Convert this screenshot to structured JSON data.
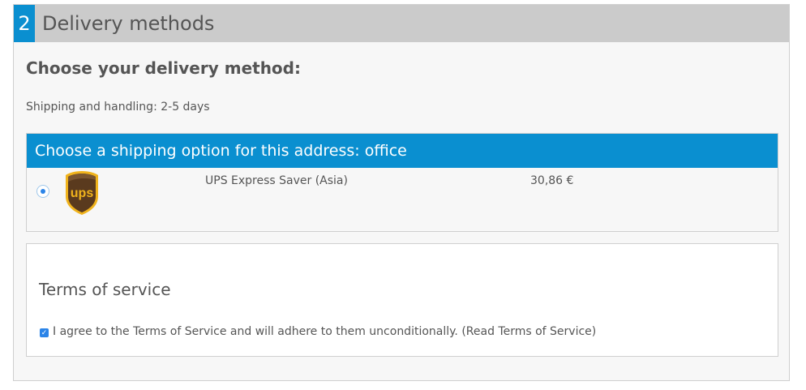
{
  "step": {
    "number": "2",
    "title": "Delivery methods"
  },
  "delivery": {
    "choose_title": "Choose your delivery method:",
    "handling_text": "Shipping and handling: 2-5 days"
  },
  "shipping": {
    "header": "Choose a shipping option for this address: office",
    "options": [
      {
        "logo_label": "ups",
        "carrier": "UPS Express Saver (Asia)",
        "price": "30,86 €",
        "selected": true
      }
    ]
  },
  "terms": {
    "title": "Terms of service",
    "agree_text": "I agree to the Terms of Service and will adhere to them unconditionally. (Read Terms of Service)",
    "checked": true
  },
  "colors": {
    "accent": "#0a8fd0",
    "header_gray": "#cbcbcb",
    "text": "#555555",
    "ups_brown": "#5a3a1e",
    "ups_gold": "#f0b31c"
  },
  "icons": {
    "carrier_logo": "ups-logo-icon",
    "radio": "radio-selected-icon",
    "checkbox": "checkbox-checked-icon"
  }
}
